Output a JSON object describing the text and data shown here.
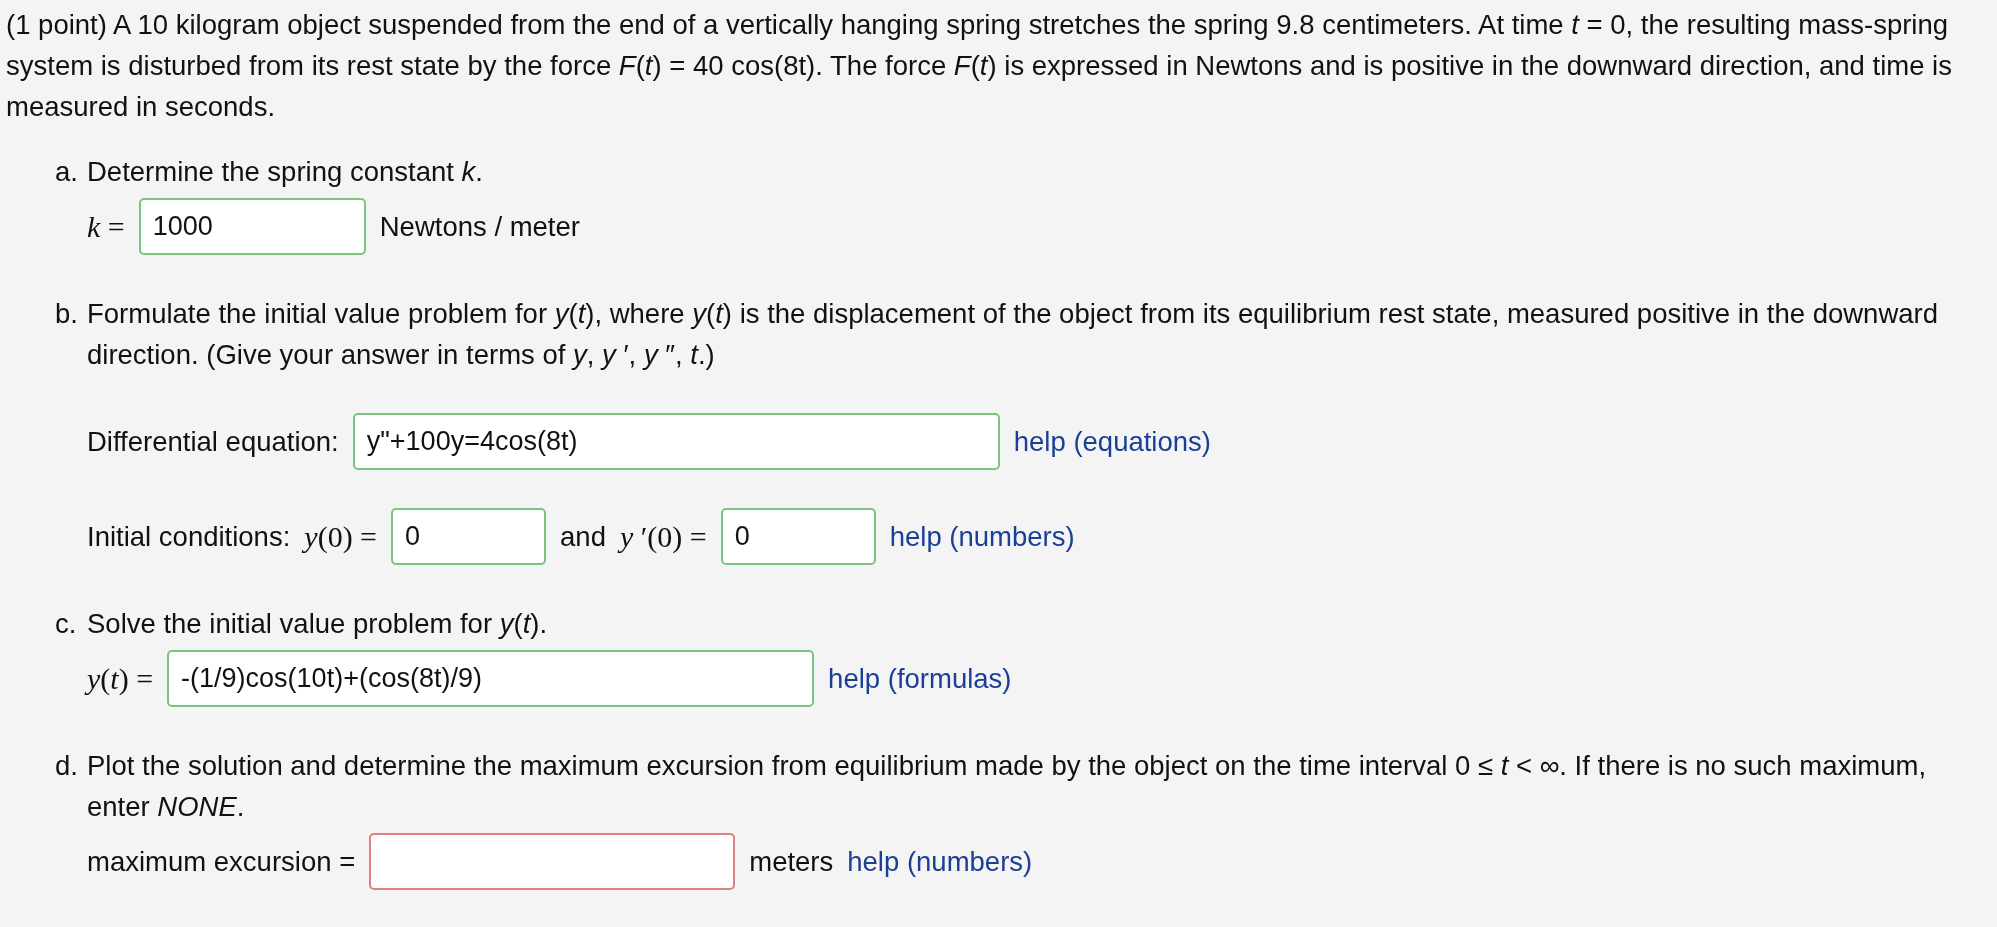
{
  "intro": "(1 point) A 10 kilogram object suspended from the end of a vertically hanging spring stretches the spring 9.8 centimeters. At time *t* = 0, the resulting mass-spring system is disturbed from its rest state by the force *F*(*t*) = 40 cos(8t). The force *F*(*t*) is expressed in Newtons and is positive in the downward direction, and time is measured in seconds.",
  "parts": [
    {
      "label": "a.",
      "text": "Determine the spring constant *k*.",
      "rows": [
        {
          "items": [
            {
              "kind": "math",
              "text": "*k* ="
            },
            {
              "kind": "input",
              "value": "1000",
              "correct": true
            },
            {
              "kind": "text",
              "text": "Newtons / meter"
            }
          ]
        }
      ]
    },
    {
      "label": "b.",
      "text": "Formulate the initial value problem for *y*(*t*), where *y*(*t*) is the displacement of the object from its equilibrium rest state, measured positive in the downward direction. (Give your answer in terms of *y*, *y* ′, *y* ″, *t*.)",
      "rows": [
        {
          "items": [
            {
              "kind": "text",
              "text": "Differential equation:"
            },
            {
              "kind": "input",
              "value": "y\"+100y=4cos(8t)",
              "correct": true
            },
            {
              "kind": "link",
              "text": "help (equations)"
            }
          ]
        },
        {
          "items": [
            {
              "kind": "text",
              "text": "Initial conditions:"
            },
            {
              "kind": "math",
              "text": "*y*(0) ="
            },
            {
              "kind": "input",
              "value": "0",
              "correct": true
            },
            {
              "kind": "text",
              "text": "and"
            },
            {
              "kind": "math",
              "text": "*y* ′(0) ="
            },
            {
              "kind": "input",
              "value": "0",
              "correct": true
            },
            {
              "kind": "link",
              "text": "help (numbers)"
            }
          ]
        }
      ]
    },
    {
      "label": "c.",
      "text": "Solve the initial value problem for *y*(*t*).",
      "rows": [
        {
          "items": [
            {
              "kind": "math",
              "text": "*y*(*t*) ="
            },
            {
              "kind": "input",
              "value": "-(1/9)cos(10t)+(cos(8t)/9)",
              "correct": true
            },
            {
              "kind": "link",
              "text": "help (formulas)"
            }
          ]
        }
      ]
    },
    {
      "label": "d.",
      "text": "Plot the solution and determine the maximum excursion from equilibrium made by the object on the time interval 0 ≤ *t* < ∞. If there is no such maximum, enter *NONE*.",
      "rows": [
        {
          "items": [
            {
              "kind": "text",
              "text": "maximum excursion ="
            },
            {
              "kind": "input",
              "correct": false
            },
            {
              "kind": "text",
              "text": "meters"
            },
            {
              "kind": "link",
              "text": "help (numbers)"
            }
          ]
        }
      ]
    }
  ]
}
